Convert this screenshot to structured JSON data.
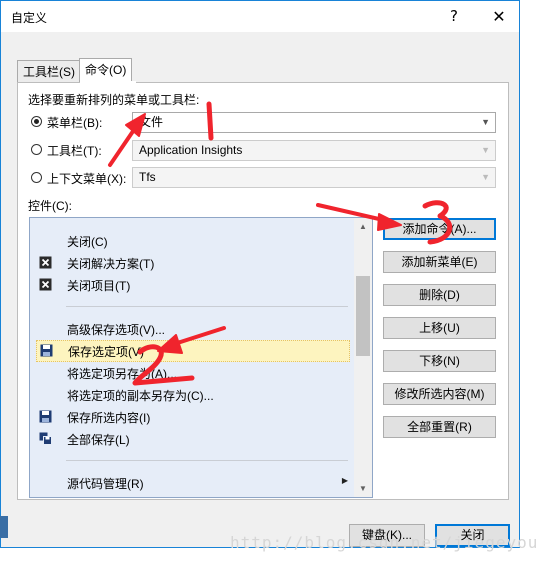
{
  "window": {
    "title": "自定义",
    "help_glyph": "?",
    "close_glyph": "✕"
  },
  "tabs": [
    {
      "label": "工具栏(S)",
      "active": false
    },
    {
      "label": "命令(O)",
      "active": true
    }
  ],
  "choose_label": "选择要重新排列的菜单或工具栏:",
  "options": [
    {
      "label": "菜单栏(B):",
      "checked": true,
      "value": "文件",
      "enabled": true
    },
    {
      "label": "工具栏(T):",
      "checked": false,
      "value": "Application Insights",
      "enabled": false
    },
    {
      "label": "上下文菜单(X):",
      "checked": false,
      "value": "Tfs",
      "enabled": false
    }
  ],
  "controls_label": "控件(C):",
  "controls": [
    {
      "label": "关闭(C)",
      "icon": "none"
    },
    {
      "label": "关闭解决方案(T)",
      "icon": "close-x"
    },
    {
      "label": "关闭项目(T)",
      "icon": "close-x"
    },
    {
      "label": "高级保存选项(V)...",
      "icon": "none"
    },
    {
      "label": "保存选定项(V)",
      "icon": "save",
      "selected": true
    },
    {
      "label": "将选定项另存为(A)...",
      "icon": "none"
    },
    {
      "label": "将选定项的副本另存为(C)...",
      "icon": "none"
    },
    {
      "label": "保存所选内容(I)",
      "icon": "save"
    },
    {
      "label": "全部保存(L)",
      "icon": "save-all"
    },
    {
      "label": "源代码管理(R)",
      "icon": "none",
      "submenu": true
    }
  ],
  "side_buttons": [
    {
      "label": "添加命令(A)..."
    },
    {
      "label": "添加新菜单(E)"
    },
    {
      "label": "删除(D)"
    },
    {
      "label": "上移(U)"
    },
    {
      "label": "下移(N)"
    },
    {
      "label": "修改所选内容(M)"
    },
    {
      "label": "全部重置(R)"
    }
  ],
  "footer": {
    "keyboard_label": "键盘(K)...",
    "close_label": "关闭"
  },
  "watermark": "http://blog.csdn.net/jiegeyou",
  "annotations": {
    "color": "#f0242d",
    "digits": [
      "1",
      "2",
      "3"
    ]
  },
  "colors": {
    "list_background": "#e6edf8",
    "selection": "#fdf4bf",
    "accent": "#0078d7"
  }
}
